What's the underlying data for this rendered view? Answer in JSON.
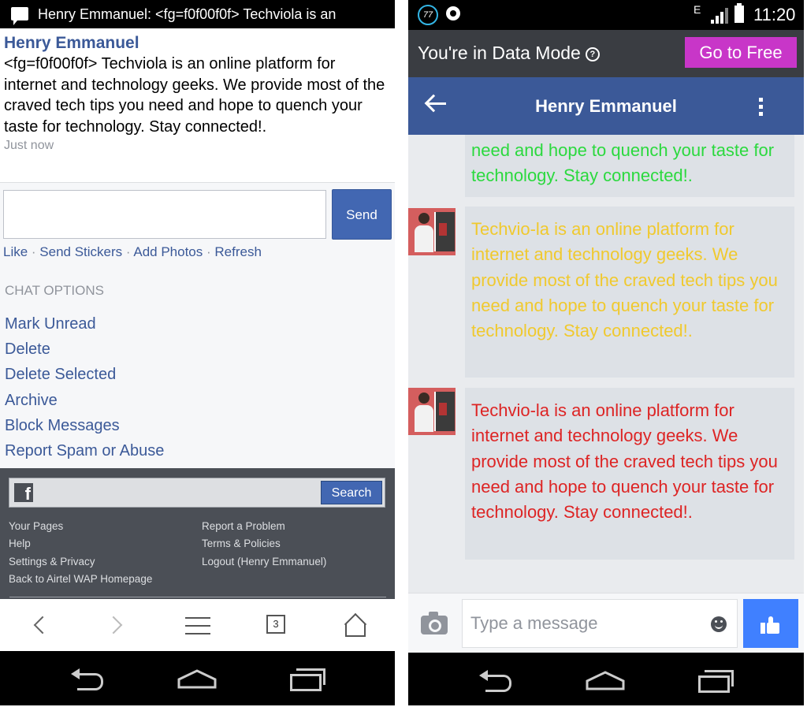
{
  "left": {
    "notification": {
      "text": "Henry Emmanuel: <fg=f0f00f0f> Techviola is an"
    },
    "message": {
      "sender": "Henry Emmanuel",
      "text": "<fg=f0f00f0f> Techviola is an online platform for internet and technology geeks. We provide most of the craved tech tips you need and hope to quench your taste for technology. Stay connected!.",
      "time": "Just now"
    },
    "compose": {
      "value": "",
      "send_label": "Send"
    },
    "actions": {
      "like": "Like",
      "send_stickers": "Send Stickers",
      "add_photos": "Add Photos",
      "refresh": "Refresh",
      "separator": " · "
    },
    "chat_options": {
      "heading": "CHAT OPTIONS",
      "items": [
        "Mark Unread",
        "Delete",
        "Delete Selected",
        "Archive",
        "Block Messages",
        "Report Spam or Abuse"
      ]
    },
    "footer": {
      "search_label": "Search",
      "logo_letter": "f",
      "col1": [
        "Your Pages",
        "Help",
        "Settings & Privacy",
        "Back to Airtel WAP Homepage"
      ],
      "col2": [
        "Report a Problem",
        "Terms & Policies",
        "Logout (Henry Emmanuel)"
      ]
    },
    "browser": {
      "tab_count": "3"
    }
  },
  "right": {
    "status_bar": {
      "badge": "77",
      "network": "E",
      "time": "11:20"
    },
    "data_mode": {
      "text": "You're in Data Mode",
      "help": "?",
      "go_free": "Go to Free"
    },
    "title_bar": {
      "title": "Henry Emmanuel"
    },
    "bubbles": [
      {
        "text": "need and hope to quench your taste for technology. Stay connected!.",
        "color": "#2bd93e"
      },
      {
        "text": " Techvio-la is an online platform for internet and technology geeks. We provide most of the craved tech tips you need and hope to quench your taste for technology. Stay connected!.",
        "color": "#f0c92e"
      },
      {
        "text": " Techvio-la is an online platform for internet and technology geeks. We provide most of the craved tech tips you need and hope to quench your taste for technology. Stay connected!.",
        "color": "#dd2424"
      }
    ],
    "input": {
      "placeholder": "Type a message",
      "value": ""
    }
  },
  "colors": {
    "facebook_blue": "#3b5998",
    "button_blue": "#4267b2",
    "go_free_purple": "#c836c8",
    "like_blue": "#4080ff"
  },
  "icons": {
    "left": [
      "message-icon",
      "facebook-logo",
      "back-icon",
      "forward-icon",
      "menu-icon",
      "tabs-icon",
      "home-icon",
      "system-back-icon",
      "system-home-icon",
      "system-recents-icon"
    ],
    "right": [
      "app-badge-icon",
      "sync-icon",
      "signal-icon",
      "battery-icon",
      "help-icon",
      "back-arrow-icon",
      "overflow-menu-icon",
      "camera-icon",
      "emoji-icon",
      "thumbs-up-icon"
    ]
  }
}
